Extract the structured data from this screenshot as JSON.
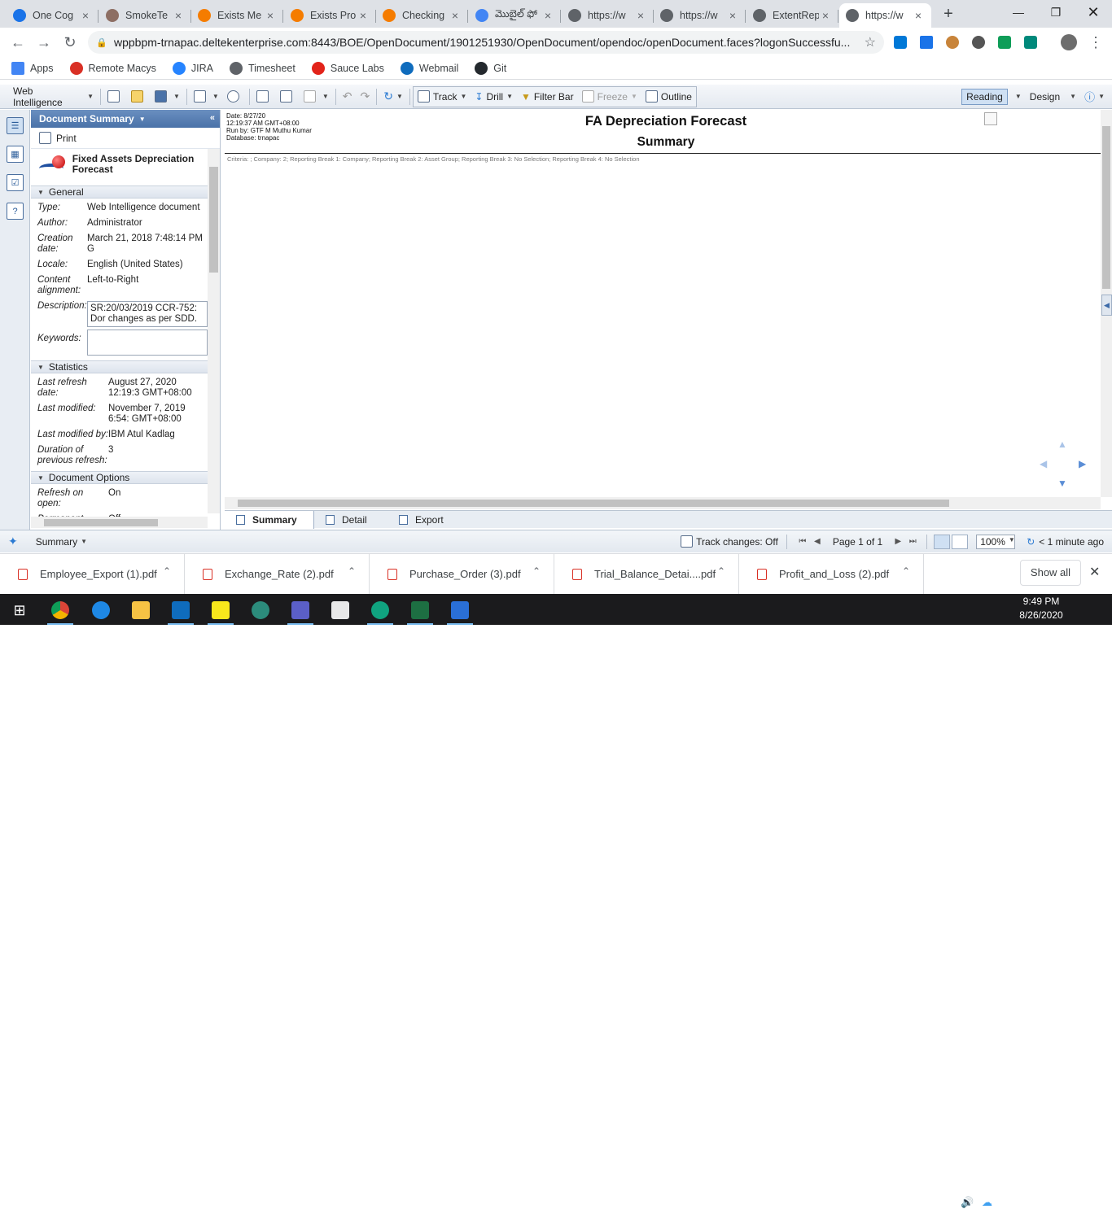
{
  "browser": {
    "tabs": [
      {
        "title": "One Cog",
        "icon": "cognizant-icon",
        "color": "#1a73e8"
      },
      {
        "title": "SmokeTe",
        "icon": "avatar-icon",
        "color": "#8d6e63"
      },
      {
        "title": "Exists Me",
        "icon": "bitbucket-icon",
        "color": "#f57c00"
      },
      {
        "title": "Exists Pro",
        "icon": "bitbucket-icon",
        "color": "#f57c00"
      },
      {
        "title": "Checking",
        "icon": "bitbucket-icon",
        "color": "#f57c00"
      },
      {
        "title": "మొబైల్ ఫో",
        "icon": "cloud-icon",
        "color": "#4285f4"
      },
      {
        "title": "https://w",
        "icon": "globe-icon",
        "color": "#5f6368"
      },
      {
        "title": "https://w",
        "icon": "globe-icon",
        "color": "#5f6368"
      },
      {
        "title": "ExtentRep",
        "icon": "globe-icon",
        "color": "#5f6368"
      },
      {
        "title": "https://w",
        "icon": "globe-icon",
        "color": "#5f6368",
        "active": true
      }
    ],
    "url": "wppbpm-trnapac.deltekenterprise.com:8443/BOE/OpenDocument/1901251930/OpenDocument/opendoc/openDocument.faces?logonSuccessfu...",
    "bookmarks": [
      {
        "label": "Apps",
        "icon": "apps-grid-icon"
      },
      {
        "label": "Remote Macys",
        "icon": "star-icon"
      },
      {
        "label": "JIRA",
        "icon": "jira-icon"
      },
      {
        "label": "Timesheet",
        "icon": "globe-icon"
      },
      {
        "label": "Sauce Labs",
        "icon": "saucelabs-icon"
      },
      {
        "label": "Webmail",
        "icon": "outlook-icon"
      },
      {
        "label": "Git",
        "icon": "github-icon"
      }
    ]
  },
  "toolbar": {
    "app_menu": "Web Intelligence",
    "track": "Track",
    "drill": "Drill",
    "filter_bar": "Filter Bar",
    "freeze": "Freeze",
    "outline": "Outline",
    "reading": "Reading",
    "design": "Design"
  },
  "panel": {
    "title": "Document Summary",
    "print": "Print",
    "doc_title": "Fixed Assets Depreciation Forecast",
    "general_header": "General",
    "general": [
      {
        "key": "Type:",
        "value": "Web Intelligence document"
      },
      {
        "key": "Author:",
        "value": "Administrator"
      },
      {
        "key": "Creation date:",
        "value": "March 21, 2018 7:48:14 PM G"
      },
      {
        "key": "Locale:",
        "value": "English (United States)"
      },
      {
        "key": "Content alignment:",
        "value": "Left-to-Right"
      }
    ],
    "description_label": "Description:",
    "description": "SR:20/03/2019 CCR-752: Dor changes as per SDD.",
    "keywords_label": "Keywords:",
    "keywords": "",
    "statistics_header": "Statistics",
    "statistics": [
      {
        "key": "Last refresh date:",
        "value": "August 27, 2020 12:19:3 GMT+08:00"
      },
      {
        "key": "Last modified:",
        "value": "November 7, 2019 6:54: GMT+08:00"
      },
      {
        "key": "Last modified by:",
        "value": "IBM Atul Kadlag"
      },
      {
        "key": "Duration of previous refresh:",
        "value": "3"
      }
    ],
    "options_header": "Document Options",
    "options": [
      {
        "key": "Refresh on open:",
        "value": "On"
      },
      {
        "key": "Permanent",
        "value": "Off"
      }
    ]
  },
  "report": {
    "meta_date": "Date: 8/27/20",
    "meta_time": "12:19:37 AM GMT+08:00",
    "meta_run_by": "Run by: GTF M Muthu Kumar",
    "meta_database": "Database: trnapac",
    "title": "FA Depreciation Forecast",
    "subtitle": "Summary",
    "criteria": "Criteria: ; Company: 2; Reporting Break 1: Company; Reporting Break 2: Asset Group; Reporting Break 3: No Selection; Reporting Break 4: No Selection"
  },
  "report_tabs": [
    "Summary",
    "Detail",
    "Export"
  ],
  "status": {
    "left_label": "Summary",
    "track_changes": "Track changes: Off",
    "page": "Page 1 of 1",
    "zoom": "100%",
    "refresh_age": "< 1 minute ago"
  },
  "downloads": {
    "files": [
      "Employee_Export (1).pdf",
      "Exchange_Rate (2).pdf",
      "Purchase_Order (3).pdf",
      "Trial_Balance_Detai....pdf",
      "Profit_and_Loss (2).pdf"
    ],
    "show_all": "Show all"
  },
  "taskbar": {
    "time": "9:49 PM",
    "date": "8/26/2020"
  }
}
